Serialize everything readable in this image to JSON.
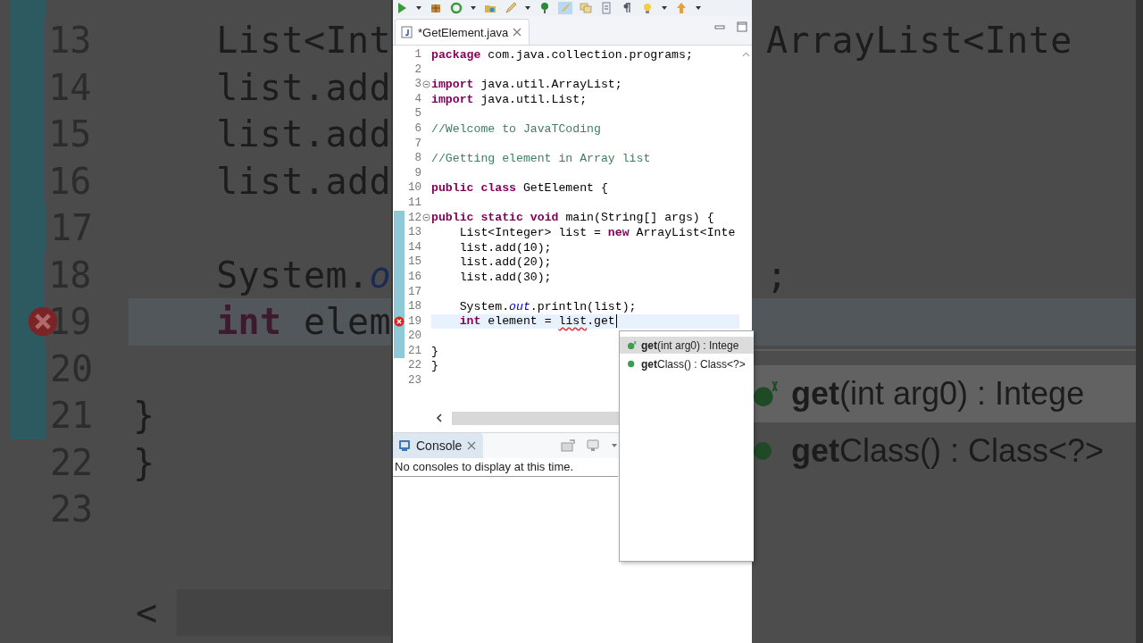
{
  "backdrop": {
    "lines": [
      {
        "number": "13",
        "changed": true,
        "error": false,
        "current": false,
        "left": [
          {
            "kind": "plain",
            "text": "    List<Int"
          }
        ],
        "right": [
          {
            "kind": "plain",
            "text": "ArrayList<Inte"
          }
        ]
      },
      {
        "number": "14",
        "changed": true,
        "error": false,
        "current": false,
        "left": [
          {
            "kind": "plain",
            "text": "    list.add"
          }
        ]
      },
      {
        "number": "15",
        "changed": true,
        "error": false,
        "current": false,
        "left": [
          {
            "kind": "plain",
            "text": "    list.add"
          }
        ]
      },
      {
        "number": "16",
        "changed": true,
        "error": false,
        "current": false,
        "left": [
          {
            "kind": "plain",
            "text": "    list.add"
          }
        ]
      },
      {
        "number": "17",
        "changed": true,
        "error": false,
        "current": false
      },
      {
        "number": "18",
        "changed": true,
        "error": false,
        "current": false,
        "left": [
          {
            "kind": "plain",
            "text": "    System."
          },
          {
            "kind": "field",
            "text": "o"
          }
        ],
        "right": [
          {
            "kind": "plain",
            "text": ";"
          }
        ]
      },
      {
        "number": "19",
        "changed": true,
        "error": true,
        "current": true,
        "left": [
          {
            "kind": "kw",
            "text": "    int"
          },
          {
            "kind": "plain",
            "text": " elem"
          }
        ]
      },
      {
        "number": "20",
        "changed": true,
        "error": false,
        "current": false
      },
      {
        "number": "21",
        "changed": true,
        "error": false,
        "current": false,
        "left": [
          {
            "kind": "plain",
            "text": "}"
          }
        ]
      },
      {
        "number": "22",
        "changed": false,
        "error": false,
        "current": false,
        "left": [
          {
            "kind": "plain",
            "text": "}"
          }
        ]
      },
      {
        "number": "23",
        "changed": false,
        "error": false,
        "current": false
      }
    ],
    "suggestions": [
      {
        "text": "**get**(int arg0) : Intege",
        "kind": "method-default",
        "selected": true
      },
      {
        "text": "**get**Class() : Class<?>",
        "kind": "method",
        "selected": false
      }
    ],
    "scroll_arrow": "<"
  },
  "toolbar": [
    {
      "kind": "run",
      "pressed": false
    },
    {
      "kind": "caret",
      "pressed": false
    },
    {
      "kind": "box",
      "pressed": false
    },
    {
      "kind": "refresh",
      "pressed": false
    },
    {
      "kind": "caret",
      "pressed": false
    },
    {
      "kind": "folder",
      "pressed": false
    },
    {
      "kind": "pencil",
      "pressed": false
    },
    {
      "kind": "caret",
      "pressed": false
    },
    {
      "kind": "pin",
      "pressed": false
    },
    {
      "kind": "brush",
      "pressed": true
    },
    {
      "kind": "windows",
      "pressed": false
    },
    {
      "kind": "page",
      "pressed": false
    },
    {
      "kind": "pilcrow",
      "pressed": false
    },
    {
      "kind": "bulb",
      "pressed": false
    },
    {
      "kind": "caret",
      "pressed": false
    },
    {
      "kind": "up",
      "pressed": false
    },
    {
      "kind": "caret",
      "pressed": false
    }
  ],
  "editor_tabs": [
    {
      "label": "*GetElement.java",
      "selected": true
    }
  ],
  "code_lines": [
    {
      "number": "1",
      "changed": false,
      "error": false,
      "current": false,
      "fold": false,
      "caret": false,
      "tokens": [
        {
          "kind": "kw",
          "text": "package"
        },
        {
          "kind": "plain",
          "text": " com.java.collection.programs;"
        }
      ]
    },
    {
      "number": "2",
      "changed": false,
      "error": false,
      "current": false,
      "fold": false,
      "caret": false
    },
    {
      "number": "3",
      "changed": false,
      "error": false,
      "current": false,
      "fold": true,
      "caret": false,
      "tokens": [
        {
          "kind": "kw",
          "text": "import"
        },
        {
          "kind": "plain",
          "text": " java.util.ArrayList;"
        }
      ]
    },
    {
      "number": "4",
      "changed": false,
      "error": false,
      "current": false,
      "fold": false,
      "caret": false,
      "tokens": [
        {
          "kind": "kw",
          "text": "import"
        },
        {
          "kind": "plain",
          "text": " java.util.List;"
        }
      ]
    },
    {
      "number": "5",
      "changed": false,
      "error": false,
      "current": false,
      "fold": false,
      "caret": false
    },
    {
      "number": "6",
      "changed": false,
      "error": false,
      "current": false,
      "fold": false,
      "caret": false,
      "tokens": [
        {
          "kind": "comment",
          "text": "//Welcome to JavaTCoding"
        }
      ]
    },
    {
      "number": "7",
      "changed": false,
      "error": false,
      "current": false,
      "fold": false,
      "caret": false
    },
    {
      "number": "8",
      "changed": false,
      "error": false,
      "current": false,
      "fold": false,
      "caret": false,
      "tokens": [
        {
          "kind": "comment",
          "text": "//Getting element in Array list"
        }
      ]
    },
    {
      "number": "9",
      "changed": false,
      "error": false,
      "current": false,
      "fold": false,
      "caret": false
    },
    {
      "number": "10",
      "changed": false,
      "error": false,
      "current": false,
      "fold": false,
      "caret": false,
      "tokens": [
        {
          "kind": "kw",
          "text": "public"
        },
        {
          "kind": "kw",
          "text": " class"
        },
        {
          "kind": "plain",
          "text": " GetElement {"
        }
      ]
    },
    {
      "number": "11",
      "changed": false,
      "error": false,
      "current": false,
      "fold": false,
      "caret": false
    },
    {
      "number": "12",
      "changed": true,
      "error": false,
      "current": false,
      "fold": true,
      "caret": false,
      "tokens": [
        {
          "kind": "kw",
          "text": "public"
        },
        {
          "kind": "kw",
          "text": " static"
        },
        {
          "kind": "kw",
          "text": " void"
        },
        {
          "kind": "plain",
          "text": " main(String[] args) {"
        }
      ]
    },
    {
      "number": "13",
      "changed": true,
      "error": false,
      "current": false,
      "fold": false,
      "caret": false,
      "tokens": [
        {
          "kind": "plain",
          "text": "    List<Integer> list = "
        },
        {
          "kind": "kw",
          "text": "new"
        },
        {
          "kind": "plain",
          "text": " ArrayList<Inte"
        }
      ]
    },
    {
      "number": "14",
      "changed": true,
      "error": false,
      "current": false,
      "fold": false,
      "caret": false,
      "tokens": [
        {
          "kind": "plain",
          "text": "    list.add(10);"
        }
      ]
    },
    {
      "number": "15",
      "changed": true,
      "error": false,
      "current": false,
      "fold": false,
      "caret": false,
      "tokens": [
        {
          "kind": "plain",
          "text": "    list.add(20);"
        }
      ]
    },
    {
      "number": "16",
      "changed": true,
      "error": false,
      "current": false,
      "fold": false,
      "caret": false,
      "tokens": [
        {
          "kind": "plain",
          "text": "    list.add(30);"
        }
      ]
    },
    {
      "number": "17",
      "changed": true,
      "error": false,
      "current": false,
      "fold": false,
      "caret": false
    },
    {
      "number": "18",
      "changed": true,
      "error": false,
      "current": false,
      "fold": false,
      "caret": false,
      "tokens": [
        {
          "kind": "plain",
          "text": "    System."
        },
        {
          "kind": "field",
          "text": "out"
        },
        {
          "kind": "plain",
          "text": ".println(list);"
        }
      ]
    },
    {
      "number": "19",
      "changed": true,
      "error": true,
      "current": true,
      "fold": false,
      "caret": true,
      "tokens": [
        {
          "kind": "kw",
          "text": "    int"
        },
        {
          "kind": "plain",
          "text": " element = "
        },
        {
          "kind": "error",
          "text": "list"
        },
        {
          "kind": "plain",
          "text": ".get"
        }
      ]
    },
    {
      "number": "20",
      "changed": true,
      "error": false,
      "current": false,
      "fold": false,
      "caret": false
    },
    {
      "number": "21",
      "changed": true,
      "error": false,
      "current": false,
      "fold": false,
      "caret": false,
      "tokens": [
        {
          "kind": "plain",
          "text": "}"
        }
      ]
    },
    {
      "number": "22",
      "changed": false,
      "error": false,
      "current": false,
      "fold": false,
      "caret": false,
      "tokens": [
        {
          "kind": "plain",
          "text": "}"
        }
      ]
    },
    {
      "number": "23",
      "changed": false,
      "error": false,
      "current": false,
      "fold": false,
      "caret": false
    }
  ],
  "content_assist": [
    {
      "text": "**get**(int arg0) : Intege",
      "kind": "method-default",
      "selected": true
    },
    {
      "text": "**get**Class() : Class<?>",
      "kind": "method",
      "selected": false
    }
  ],
  "console": {
    "tabs": [
      {
        "label": "Console",
        "selected": true
      }
    ],
    "message": "No consoles to display at this time."
  }
}
